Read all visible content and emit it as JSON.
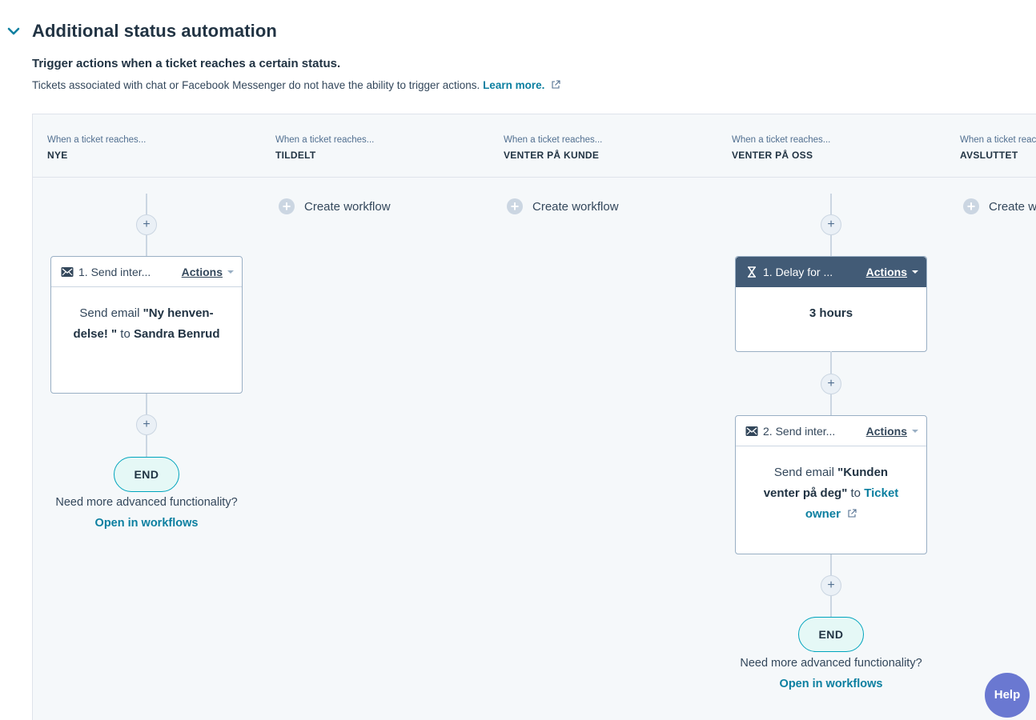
{
  "section": {
    "title": "Additional status automation"
  },
  "subtitle": "Trigger actions when a ticket reaches a certain status.",
  "description": {
    "text": "Tickets associated with chat or Facebook Messenger do not have the ability to trigger actions.",
    "link": "Learn more."
  },
  "columns": [
    {
      "pre": "When a ticket reaches...",
      "name": "NYE",
      "steps": [
        {
          "title": "1. Send inter...",
          "actions": "Actions",
          "icon": "mail-icon",
          "body": {
            "prefix": "Send email ",
            "strong": "\"Ny henven-delse! \"",
            "mid": " to ",
            "target": "Sandra Benrud"
          }
        }
      ],
      "end_label": "END",
      "need_text": "Need more advanced functionality?",
      "open_link": "Open in workflows"
    },
    {
      "pre": "When a ticket reaches...",
      "name": "TILDELT",
      "create_label": "Create workflow"
    },
    {
      "pre": "When a ticket reaches...",
      "name": "VENTER PÅ KUNDE",
      "create_label": "Create workflow"
    },
    {
      "pre": "When a ticket reaches...",
      "name": "VENTER PÅ OSS",
      "steps": [
        {
          "title": "1. Delay for ...",
          "actions": "Actions",
          "icon": "hourglass-icon",
          "body": {
            "strong": "3 hours"
          }
        },
        {
          "title": "2. Send inter...",
          "actions": "Actions",
          "icon": "mail-icon",
          "body": {
            "prefix": "Send email ",
            "strong": "\"Kunden venter på deg\"",
            "mid": " to ",
            "target_link": "Ticket owner"
          }
        }
      ],
      "end_label": "END",
      "need_text": "Need more advanced functionality?",
      "open_link": "Open in workflows"
    },
    {
      "pre": "When a ticket reaches...",
      "name": "AVSLUTTET",
      "create_label": "Create workflow"
    }
  ],
  "add_symbol": "+",
  "help_label": "Help",
  "colors": {
    "accent_link": "#0b7fa0",
    "dark_header": "#425b76",
    "help": "#6a78d1",
    "end_border": "#00a4bd"
  }
}
